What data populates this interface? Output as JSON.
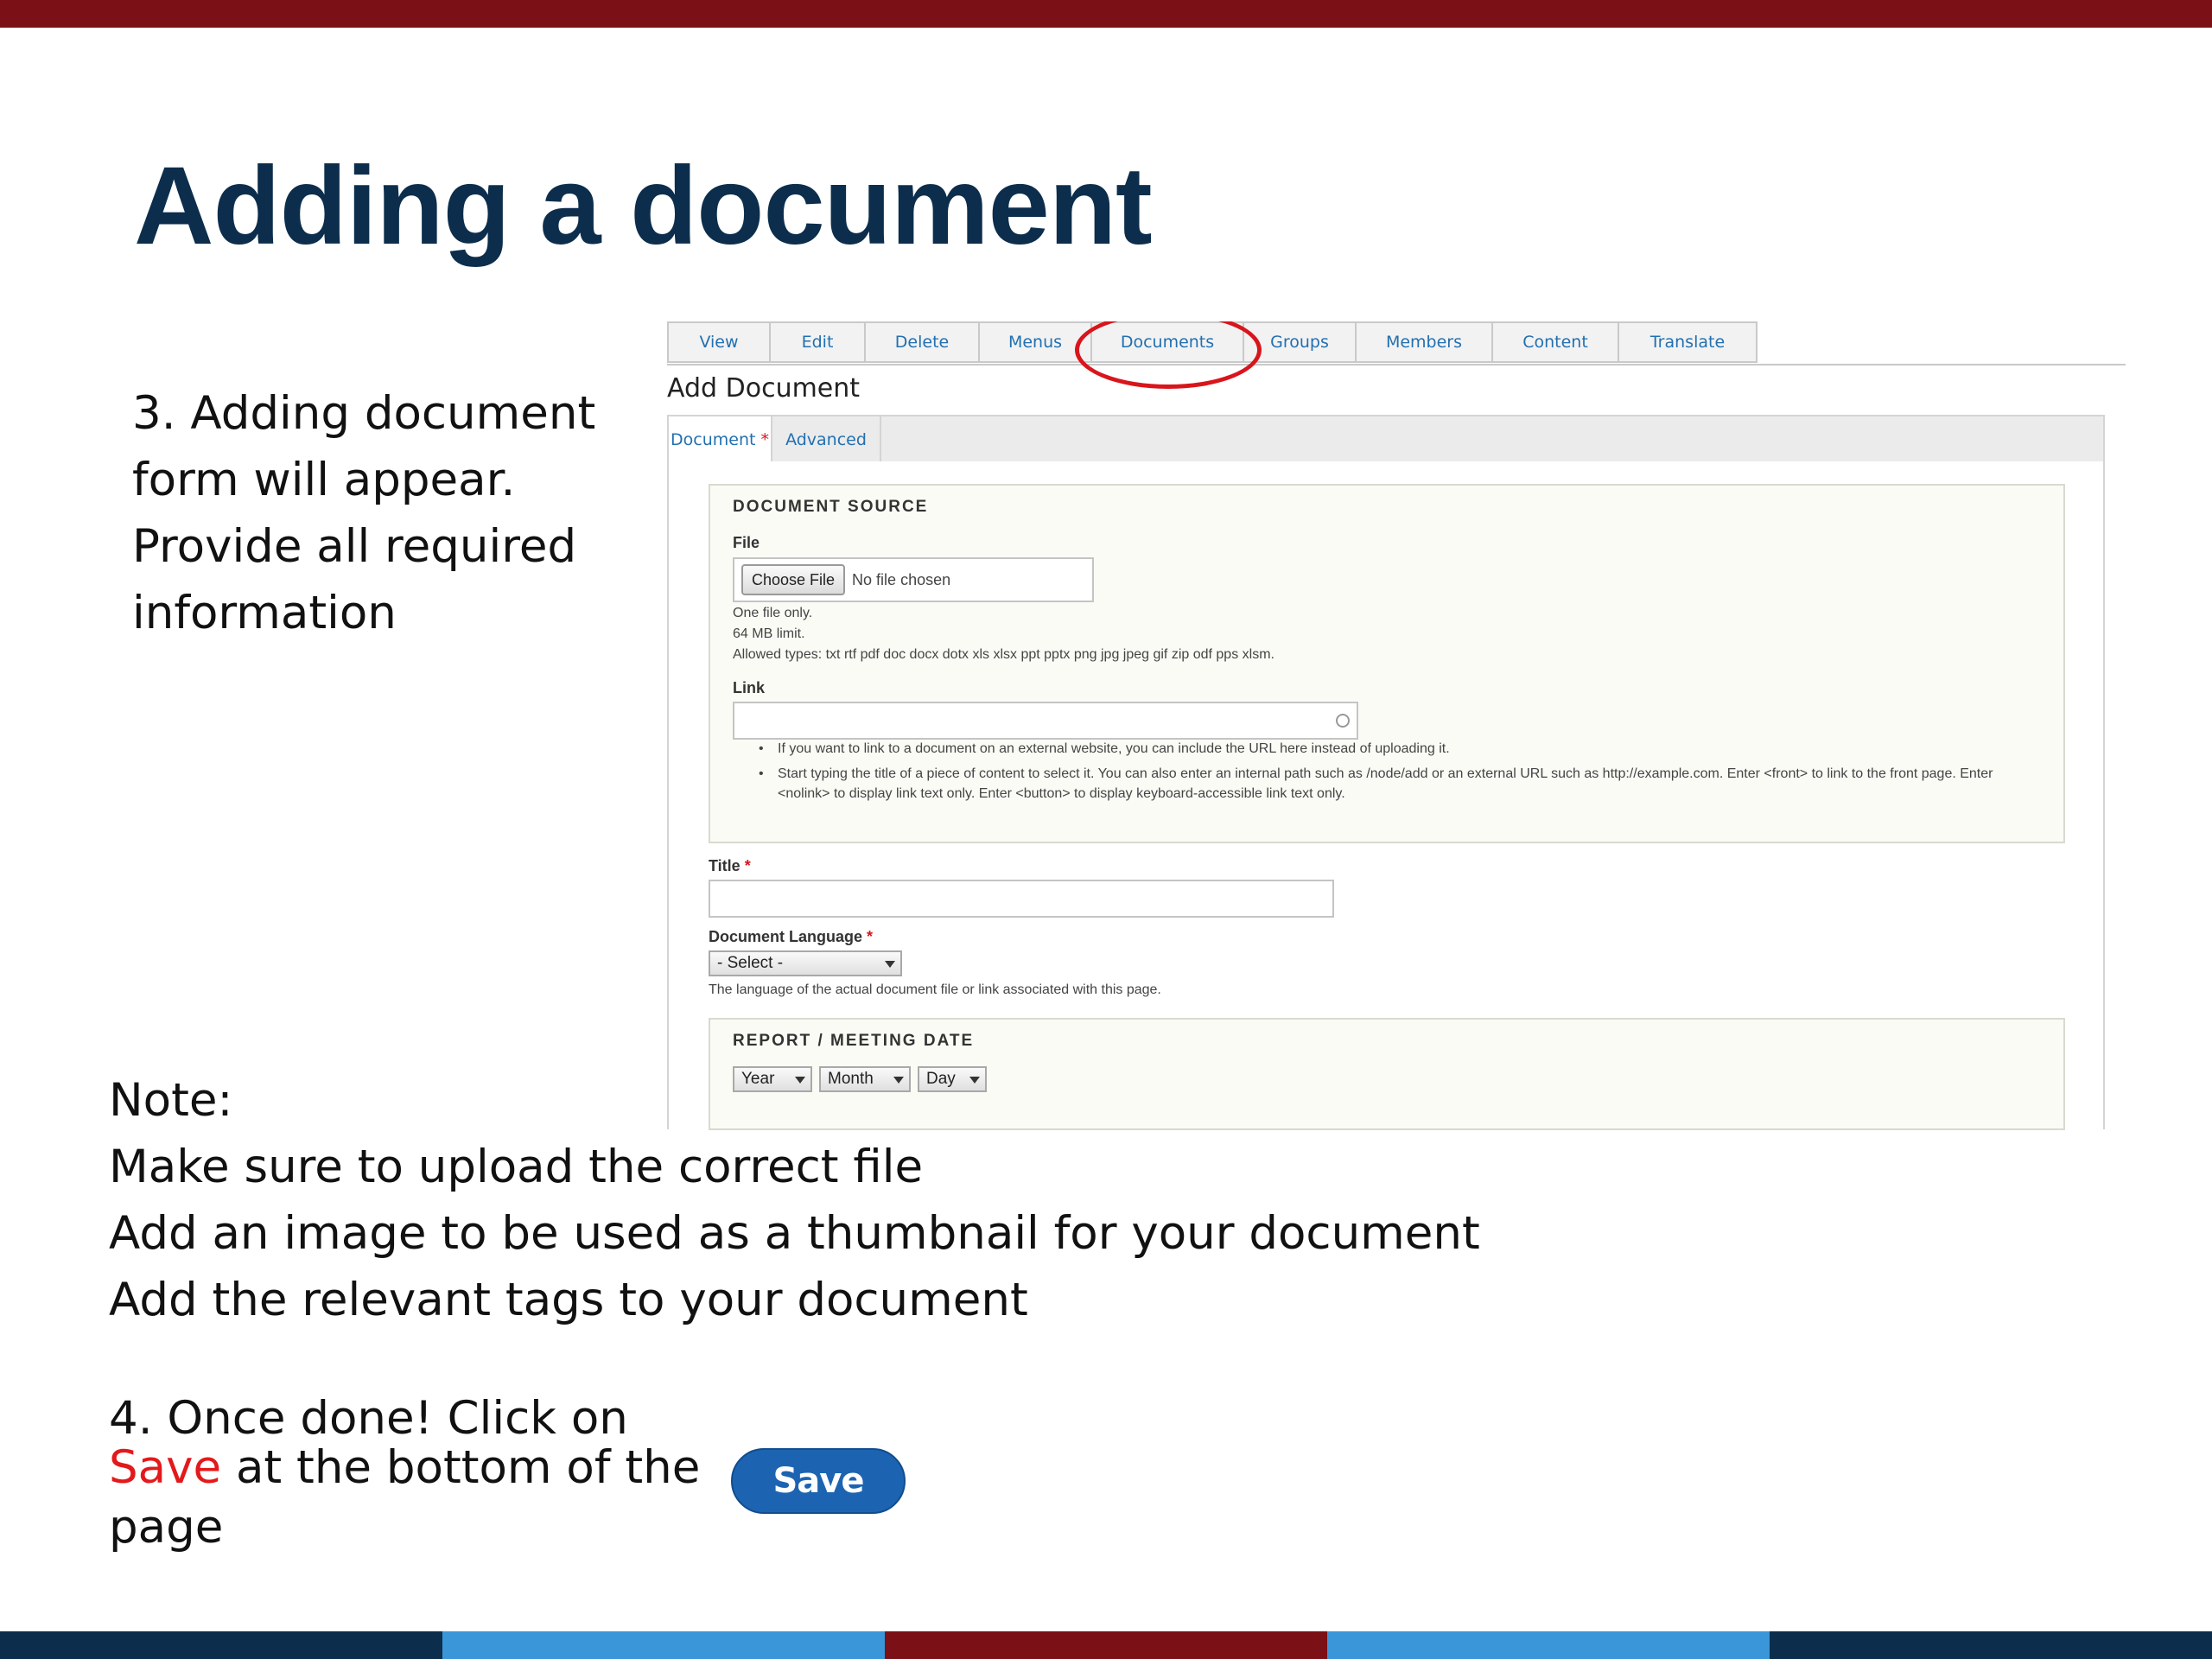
{
  "slide": {
    "title": "Adding a document",
    "step3": [
      "3. Adding document",
      "form will appear.",
      "Provide all required",
      "information"
    ],
    "note": [
      "Note:",
      "Make sure to upload the correct file",
      "Add an image to be used as a thumbnail for your document",
      "Add the relevant tags to your document"
    ],
    "step4": {
      "line1": "4. Once done! Click on",
      "save_word": "Save",
      "line2_rest": " at the bottom of the",
      "line3": "page"
    },
    "save_button": "Save",
    "colors": {
      "top_bar": "#7b1116",
      "bottom_bar": [
        "#0c2e4c",
        "#3a96d8",
        "#7b1116",
        "#3a96d8",
        "#0c2e4c"
      ],
      "title": "#0c2e4c",
      "save_accent": "#e3191b",
      "highlight_circle": "#d9151c"
    }
  },
  "screenshot": {
    "tabs": [
      "View",
      "Edit",
      "Delete",
      "Menus",
      "Documents",
      "Groups",
      "Members",
      "Content",
      "Translate"
    ],
    "highlighted_tab": "Documents",
    "form_title": "Add Document",
    "sub_tabs": {
      "document": "Document",
      "advanced": "Advanced"
    },
    "document_source": {
      "legend": "DOCUMENT SOURCE",
      "file_label": "File",
      "choose_file": "Choose File",
      "no_file": "No file chosen",
      "help": [
        "One file only.",
        "64 MB limit.",
        "Allowed types: txt rtf pdf doc docx dotx xls xlsx ppt pptx png jpg jpeg gif zip odf pps xlsm."
      ],
      "link_label": "Link",
      "link_value": "",
      "link_help": [
        "If you want to link to a document on an external website, you can include the URL here instead of uploading it.",
        "Start typing the title of a piece of content to select it. You can also enter an internal path such as /node/add or an external URL such as http://example.com. Enter <front> to link to the front page. Enter <nolink> to display link text only. Enter <button> to display keyboard-accessible link text only."
      ]
    },
    "title_label": "Title",
    "title_value": "",
    "language_label": "Document Language",
    "language_select": "- Select -",
    "language_help": "The language of the actual document file or link associated with this page.",
    "report_date": {
      "legend": "REPORT / MEETING DATE",
      "year": "Year",
      "month": "Month",
      "day": "Day"
    }
  }
}
